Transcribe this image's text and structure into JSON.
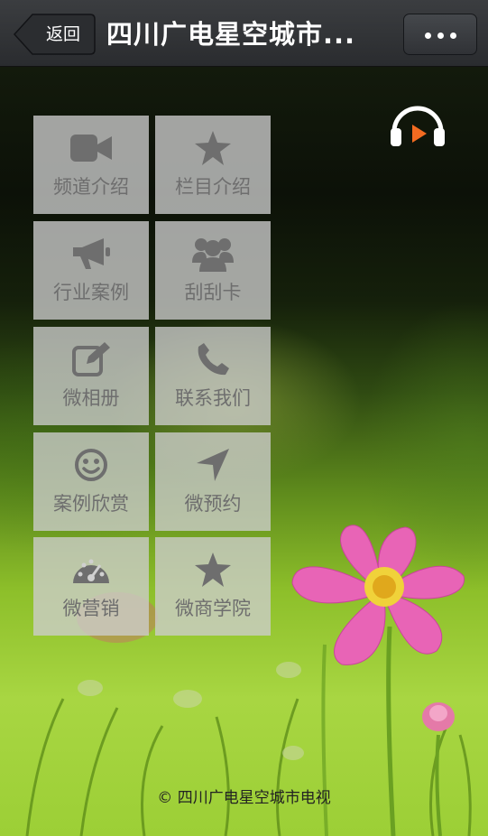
{
  "topbar": {
    "back_label": "返回",
    "title": "四川广电星空城市...",
    "more_icon": "more-dots-icon"
  },
  "menu": [
    {
      "label": "频道介绍",
      "icon": "video-camera-icon"
    },
    {
      "label": "栏目介绍",
      "icon": "star-icon"
    },
    {
      "label": "行业案例",
      "icon": "megaphone-icon"
    },
    {
      "label": "刮刮卡",
      "icon": "users-icon"
    },
    {
      "label": "微相册",
      "icon": "edit-icon"
    },
    {
      "label": "联系我们",
      "icon": "phone-icon"
    },
    {
      "label": "案例欣赏",
      "icon": "smile-icon"
    },
    {
      "label": "微预约",
      "icon": "location-arrow-icon"
    },
    {
      "label": "微营销",
      "icon": "dashboard-icon"
    },
    {
      "label": "微商学院",
      "icon": "star-icon"
    }
  ],
  "audio": {
    "icon": "headphones-play-icon",
    "accent": "#f26b21"
  },
  "footer": {
    "copyright": "© 四川广电星空城市电视"
  },
  "colors": {
    "tile_icon": "#6e6e6e",
    "topbar": "#2f3134"
  }
}
